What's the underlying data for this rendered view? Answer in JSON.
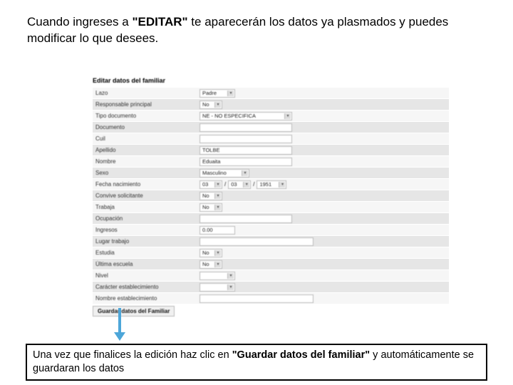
{
  "intro": {
    "t1": "Cuando ingreses a ",
    "em": "\"EDITAR\"",
    "t2": " te aparecerán los datos ya plasmados y puedes modificar lo que desees."
  },
  "form": {
    "title": "Editar datos del familiar",
    "rows": {
      "lazo": {
        "label": "Lazo",
        "value": "Padre"
      },
      "resp": {
        "label": "Responsable principal",
        "value": "No"
      },
      "tipodoc": {
        "label": "Tipo documento",
        "value": "NE - NO ESPECIFICA"
      },
      "documento": {
        "label": "Documento",
        "value": ""
      },
      "cuil": {
        "label": "Cuil",
        "value": ""
      },
      "apellido": {
        "label": "Apellido",
        "value": "TOLBE"
      },
      "nombre": {
        "label": "Nombre",
        "value": "Eduaita"
      },
      "sexo": {
        "label": "Sexo",
        "value": "Masculino"
      },
      "fecha": {
        "label": "Fecha nacimiento",
        "d": "03",
        "m": "03",
        "y": "1951"
      },
      "convive": {
        "label": "Convive solicitante",
        "value": "No"
      },
      "trabaja": {
        "label": "Trabaja",
        "value": "No"
      },
      "ocupacion": {
        "label": "Ocupación",
        "value": ""
      },
      "ingresos": {
        "label": "Ingresos",
        "value": "0.00"
      },
      "lugartrab": {
        "label": "Lugar trabajo",
        "value": ""
      },
      "estudia": {
        "label": "Estudia",
        "value": "No"
      },
      "ultimaesc": {
        "label": "Última escuela",
        "value": "No"
      },
      "nivel": {
        "label": "Nivel",
        "value": ""
      },
      "caracter": {
        "label": "Carácter establecimiento",
        "value": ""
      },
      "nombreest": {
        "label": "Nombre establecimiento",
        "value": ""
      }
    },
    "save_label": "Guardar datos del Familiar"
  },
  "note": {
    "t1": "Una vez que finalices la edición haz clic en ",
    "b": "\"Guardar datos del familiar\"",
    "t2": " y automáticamente se guardaran los datos"
  }
}
